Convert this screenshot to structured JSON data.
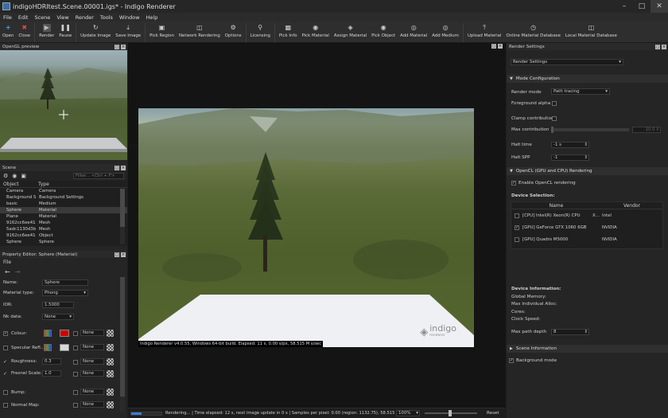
{
  "window": {
    "title": "indigoHDRItest.Scene.00001.igs* - Indigo Renderer"
  },
  "menu": [
    "File",
    "Edit",
    "Scene",
    "View",
    "Render",
    "Tools",
    "Window",
    "Help"
  ],
  "toolbar": [
    {
      "label": "Open",
      "icon": "plus-icon",
      "color": "#4aa3e0"
    },
    {
      "label": "Close",
      "icon": "x-icon",
      "color": "#e24a3a"
    },
    {
      "label": "Render",
      "icon": "play-icon",
      "color": "#9a9a9a"
    },
    {
      "label": "Pause",
      "icon": "pause-icon",
      "color": "#cfcfcf"
    },
    {
      "label": "Update Image",
      "icon": "refresh-icon",
      "color": "#cfcfcf"
    },
    {
      "label": "Save Image",
      "icon": "download-icon",
      "color": "#cfcfcf"
    },
    {
      "label": "Pick Region",
      "icon": "region-icon",
      "color": "#cfcfcf"
    },
    {
      "label": "Network Rendering",
      "icon": "network-icon",
      "color": "#cfcfcf"
    },
    {
      "label": "Options",
      "icon": "gear-icon",
      "color": "#cfcfcf"
    },
    {
      "label": "Licensing",
      "icon": "key-icon",
      "color": "#cfcfcf"
    },
    {
      "label": "Pick Info",
      "icon": "chart-icon",
      "color": "#cfcfcf"
    },
    {
      "label": "Pick Material",
      "icon": "material-icon",
      "color": "#cfcfcf"
    },
    {
      "label": "Assign Material",
      "icon": "assign-icon",
      "color": "#cfcfcf"
    },
    {
      "label": "Pick Object",
      "icon": "object-icon",
      "color": "#cfcfcf"
    },
    {
      "label": "Add Material",
      "icon": "add-material-icon",
      "color": "#cfcfcf"
    },
    {
      "label": "Add Medium",
      "icon": "add-medium-icon",
      "color": "#cfcfcf"
    },
    {
      "label": "Upload Material",
      "icon": "upload-icon",
      "color": "#cfcfcf"
    },
    {
      "label": "Online Material Database",
      "icon": "globe-icon",
      "color": "#cfcfcf"
    },
    {
      "label": "Local Material Database",
      "icon": "database-icon",
      "color": "#cfcfcf"
    }
  ],
  "opengl": {
    "title": "OpenGL preview"
  },
  "scene": {
    "title": "Scene",
    "filter_placeholder": "Filter... <Ctrl + F>",
    "headers": [
      "Object",
      "Type"
    ],
    "rows": [
      [
        "Camera",
        "Camera"
      ],
      [
        "Background S...",
        "Background Settings"
      ],
      [
        "basic",
        "Medium"
      ],
      [
        "Sphere",
        "Material"
      ],
      [
        "Plane",
        "Material"
      ],
      [
        "9162cc6ee41c...",
        "Mesh"
      ],
      [
        "5adc1130d3b...",
        "Mesh"
      ],
      [
        "9162cc6ee41c...",
        "Object"
      ],
      [
        "Sphere",
        "Sphere"
      ]
    ]
  },
  "property": {
    "title": "Property Editor: Sphere (Material)",
    "file_label": "File",
    "name_label": "Name:",
    "name_value": "Sphere",
    "material_type_label": "Material type:",
    "material_type_value": "Phong",
    "ior_label": "IOR:",
    "ior_value": "1.5000",
    "nk_label": "Nk data:",
    "nk_value": "None",
    "colour_label": "Colour:",
    "specular_label": "Specular Refl...:",
    "roughness_label": "Roughness:",
    "roughness_value": "0.3",
    "fresnel_label": "Fresnel Scale:",
    "fresnel_value": "1.0",
    "bump_label": "Bump:",
    "normal_label": "Normal Map:",
    "none_text": "None",
    "colour_swatch": "#cc0000"
  },
  "render": {
    "overlay_text": "Indigo Renderer v4.0.55, Windows 64-bit build. Elapsed: 11 s, 0.00 s/px, 58.515 M s/sec",
    "logo_text": "indigo",
    "logo_sub": "renderer"
  },
  "status": {
    "text": "Rendering... | Time elapsed: 12 s, next image update in 0 s | Samples per pixel: 0.00 (region: 1132.75), 58.515 M s... | Zoom:",
    "zoom": "100%",
    "reset": "Reset",
    "progress": 0.35
  },
  "settings": {
    "title": "Render Settings",
    "dropdown": "Render Settings",
    "mode_section": "Mode Configuration",
    "render_mode_label": "Render mode",
    "render_mode_value": "Path tracing",
    "fg_alpha_label": "Foreground alpha",
    "clamp_label": "Clamp contributions",
    "max_contrib_label": "Max contribution",
    "max_contrib_value": "10.0",
    "halt_time_label": "Halt time",
    "halt_time_value": "-1 s",
    "halt_spp_label": "Halt SPP",
    "halt_spp_value": "-1",
    "opencl_section": "OpenCL (GPU and CPU) Rendering",
    "enable_opencl_label": "Enable OpenCL rendering",
    "device_selection_label": "Device Selection:",
    "device_headers": [
      "Name",
      "Vendor"
    ],
    "devices": [
      {
        "name": "[CPU] Intel(R) Xeon(R) CPU",
        "extra": "X...",
        "vendor": "Intel",
        "checked": false
      },
      {
        "name": "[GPU] GeForce GTX 1060 6GB",
        "extra": "",
        "vendor": "NVIDIA",
        "checked": true
      },
      {
        "name": "[GPU] Quadro M5000",
        "extra": "",
        "vendor": "NVIDIA",
        "checked": false
      }
    ],
    "device_info_label": "Device Information:",
    "global_memory": "Global Memory:",
    "max_alloc": "Max Individual Alloc:",
    "cores": "Cores:",
    "clock": "Clock Speed:",
    "max_path_label": "Max path depth",
    "max_path_value": "8",
    "scene_info_section": "Scene Information",
    "bg_mode_label": "Background mode"
  }
}
